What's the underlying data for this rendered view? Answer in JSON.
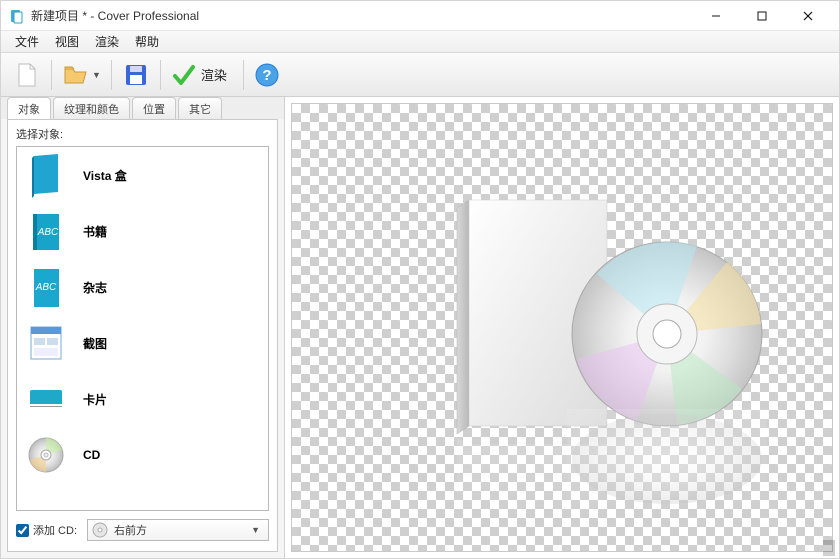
{
  "window": {
    "title": "新建项目 * - Cover Professional"
  },
  "menu": {
    "file": "文件",
    "view": "视图",
    "render": "渲染",
    "help": "帮助"
  },
  "toolbar": {
    "render_label": "渲染"
  },
  "tabs": {
    "t0": "对象",
    "t1": "纹理和颜色",
    "t2": "位置",
    "t3": "其它"
  },
  "panel": {
    "select_object_label": "选择对象:",
    "items": [
      {
        "label": "Vista 盒",
        "icon": "box-blue"
      },
      {
        "label": "书籍",
        "icon": "book-blue"
      },
      {
        "label": "杂志",
        "icon": "magazine-blue"
      },
      {
        "label": "截图",
        "icon": "screenshot"
      },
      {
        "label": "卡片",
        "icon": "card-teal"
      },
      {
        "label": "CD",
        "icon": "cd-disc"
      }
    ]
  },
  "bottom": {
    "add_cd_label": "添加 CD:",
    "position_label": "右前方"
  },
  "colors": {
    "toolbar_blue": "#2a7bd6",
    "accent_green": "#3fbf3f"
  }
}
